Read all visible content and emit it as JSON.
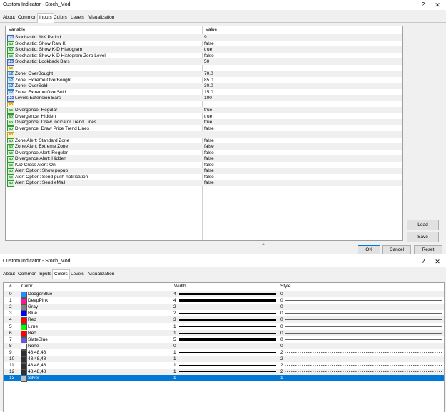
{
  "win1": {
    "title": "Custom Indicator - Stoch_Mod",
    "help": "?",
    "close": "✕",
    "tabs": [
      "About",
      "Common",
      "Inputs",
      "Colors",
      "Levels",
      "Visualization"
    ],
    "active_tab": "Inputs",
    "headers": {
      "variable": "Variable",
      "value": "Value"
    },
    "rows": [
      {
        "type": "int",
        "name": "Stochastic: %K Period",
        "value": "9"
      },
      {
        "type": "bool",
        "name": "Stochastic: Show Raw K",
        "value": "false"
      },
      {
        "type": "bool",
        "name": "Stochastic: Show K-D Histogram",
        "value": "true"
      },
      {
        "type": "bool",
        "name": "Stochastic: Show K-D Histogram Zero Level",
        "value": "false"
      },
      {
        "type": "int",
        "name": "Stochastic: Lookback Bars",
        "value": "50"
      },
      {
        "type": "str",
        "name": "",
        "value": ""
      },
      {
        "type": "dbl",
        "name": "Zone: OverBought",
        "value": "70.0"
      },
      {
        "type": "dbl",
        "name": "Zone: Extreme OverBought",
        "value": "85.0"
      },
      {
        "type": "dbl",
        "name": "Zone: OverSold",
        "value": "30.0"
      },
      {
        "type": "dbl",
        "name": "Zone: Extreme OverSold",
        "value": "15.0"
      },
      {
        "type": "int",
        "name": "Levels Extension Bars",
        "value": "100"
      },
      {
        "type": "str",
        "name": "",
        "value": ""
      },
      {
        "type": "bool",
        "name": "Divergence: Regular",
        "value": "true"
      },
      {
        "type": "bool",
        "name": "Divergence: Hidden",
        "value": "true"
      },
      {
        "type": "bool",
        "name": "Divergence: Draw Indicator Trend Lines",
        "value": "true"
      },
      {
        "type": "bool",
        "name": "Divergence: Draw Price Trend Lines",
        "value": "false"
      },
      {
        "type": "str",
        "name": "",
        "value": ""
      },
      {
        "type": "bool",
        "name": "Zone Alert: Standard Zone",
        "value": "false"
      },
      {
        "type": "bool",
        "name": "Zone Alert: Extreme Zone",
        "value": "false"
      },
      {
        "type": "bool",
        "name": "Divergence Alert: Regular",
        "value": "false"
      },
      {
        "type": "bool",
        "name": "Divergence Alert: Hidden",
        "value": "false"
      },
      {
        "type": "bool",
        "name": "K/D Cross Alert: On",
        "value": "false"
      },
      {
        "type": "bool",
        "name": "Alert Option: Show popup",
        "value": "false"
      },
      {
        "type": "bool",
        "name": "Alert Option: Send push-notification",
        "value": "false"
      },
      {
        "type": "bool",
        "name": "Alert Option: Send eMail",
        "value": "false"
      }
    ],
    "icons": {
      "bool": "ab",
      "int": "123",
      "dbl": "1/2",
      "str": "ab"
    },
    "buttons": {
      "load": "Load",
      "save": "Save",
      "ok": "OK",
      "cancel": "Cancel",
      "reset": "Reset"
    }
  },
  "win2": {
    "title": "Custom Indicator - Stoch_Mod",
    "help": "?",
    "close": "✕",
    "tabs": [
      "About",
      "Common",
      "Inputs",
      "Colors",
      "Levels",
      "Visualization"
    ],
    "active_tab": "Colors",
    "headers": {
      "index": "#",
      "color": "Color",
      "width": "Width",
      "style": "Style"
    },
    "rows": [
      {
        "index": "0",
        "color_name": "DodgerBlue",
        "hex": "#1e90ff",
        "width": "4",
        "style": "0"
      },
      {
        "index": "1",
        "color_name": "DeepPink",
        "hex": "#ff1493",
        "width": "4",
        "style": "0"
      },
      {
        "index": "2",
        "color_name": "Gray",
        "hex": "#808080",
        "width": "2",
        "style": "0"
      },
      {
        "index": "3",
        "color_name": "Blue",
        "hex": "#0000ff",
        "width": "2",
        "style": "0"
      },
      {
        "index": "4",
        "color_name": "Red",
        "hex": "#ff0000",
        "width": "3",
        "style": "0"
      },
      {
        "index": "5",
        "color_name": "Lime",
        "hex": "#00ff00",
        "width": "1",
        "style": "0"
      },
      {
        "index": "6",
        "color_name": "Red",
        "hex": "#ff0000",
        "width": "1",
        "style": "0"
      },
      {
        "index": "7",
        "color_name": "SlateBlue",
        "hex": "#6a5acd",
        "width": "5",
        "style": "0"
      },
      {
        "index": "8",
        "color_name": "None",
        "hex": "#ffffff",
        "width": "0",
        "style": "0"
      },
      {
        "index": "9",
        "color_name": "48,48,48",
        "hex": "#303030",
        "width": "1",
        "style": "2"
      },
      {
        "index": "10",
        "color_name": "48,48,48",
        "hex": "#303030",
        "width": "1",
        "style": "2"
      },
      {
        "index": "11",
        "color_name": "48,48,48",
        "hex": "#303030",
        "width": "1",
        "style": "2"
      },
      {
        "index": "12",
        "color_name": "48,48,48",
        "hex": "#303030",
        "width": "1",
        "style": "2"
      },
      {
        "index": "13",
        "color_name": "Silver",
        "hex": "#c0c0c0",
        "width": "1",
        "style": "1",
        "selected": true
      }
    ]
  }
}
